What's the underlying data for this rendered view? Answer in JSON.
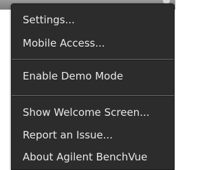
{
  "menu": {
    "items": [
      {
        "label": "Settings..."
      },
      {
        "label": "Mobile Access..."
      },
      {
        "label": "Enable Demo Mode"
      },
      {
        "label": "Show Welcome Screen..."
      },
      {
        "label": "Report an Issue..."
      },
      {
        "label": "About Agilent BenchVue"
      }
    ]
  }
}
